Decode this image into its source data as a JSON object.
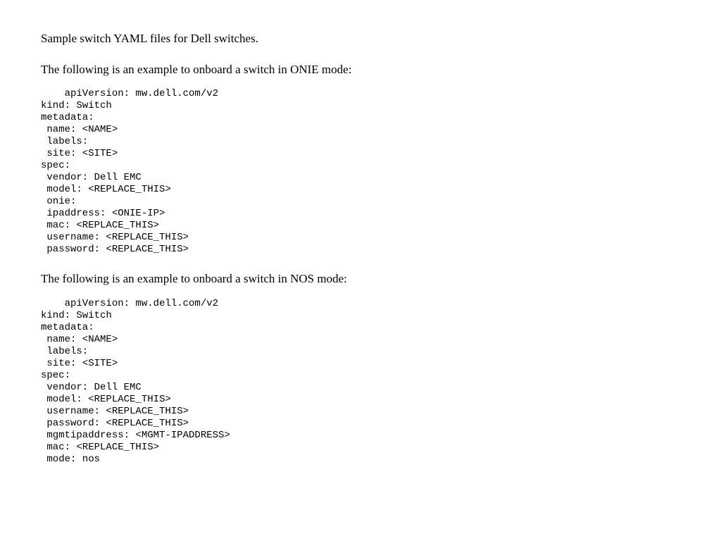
{
  "intro": "Sample switch YAML files for Dell switches.",
  "section1_label": "The following is an example to onboard a switch in ONIE mode:",
  "code1": "    apiVersion: mw.dell.com/v2\nkind: Switch\nmetadata:\n name: <NAME>\n labels:\n site: <SITE>\nspec:\n vendor: Dell EMC\n model: <REPLACE_THIS>\n onie:\n ipaddress: <ONIE-IP>\n mac: <REPLACE_THIS>\n username: <REPLACE_THIS>\n password: <REPLACE_THIS>",
  "section2_label": "The following is an example to onboard a switch in NOS mode:",
  "code2": "    apiVersion: mw.dell.com/v2\nkind: Switch\nmetadata:\n name: <NAME>\n labels:\n site: <SITE>\nspec:\n vendor: Dell EMC\n model: <REPLACE_THIS>\n username: <REPLACE_THIS>\n password: <REPLACE_THIS>\n mgmtipaddress: <MGMT-IPADDRESS>\n mac: <REPLACE_THIS>\n mode: nos"
}
